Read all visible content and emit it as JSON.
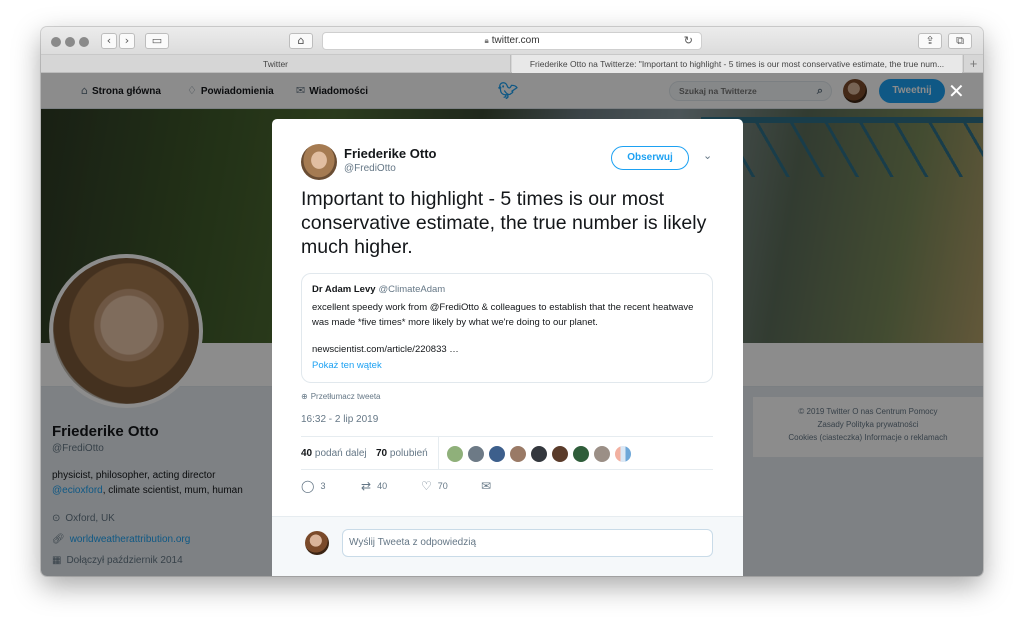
{
  "browser": {
    "url": "twitter.com",
    "tabs": [
      {
        "label": "Twitter"
      },
      {
        "label": "Friederike Otto na Twitterze: \"Important to highlight - 5 times is our most conservative estimate, the true num..."
      }
    ],
    "new_tab_label": "+"
  },
  "navbar": {
    "home": "Strona główna",
    "notifications": "Powiadomienia",
    "messages": "Wiadomości",
    "search_placeholder": "Szukaj na Twitterze",
    "tweet_button": "Tweetnij"
  },
  "profile": {
    "name": "Friederike Otto",
    "handle": "@FrediOtto",
    "bio_part1": "physicist, philosopher, acting director",
    "bio_link": "@ecioxford",
    "bio_part2": ", climate scientist, mum, human",
    "location": "Oxford, UK",
    "website": "worldweatherattribution.org",
    "joined": "Dołączył październik 2014"
  },
  "footer": {
    "line1": "© 2019 Twitter   O nas   Centrum Pomocy",
    "line2": "Zasady   Polityka prywatności",
    "line3": "Cookies (ciasteczka)   Informacje o reklamach"
  },
  "tweet": {
    "author_name": "Friederike Otto",
    "author_handle": "@FrediOtto",
    "follow_label": "Obserwuj",
    "text": "Important to highlight - 5 times is our most conservative estimate, the true number is likely much higher.",
    "quote": {
      "name": "Dr Adam Levy",
      "handle": "@ClimateAdam",
      "body": "excellent speedy work from @FrediOtto & colleagues to establish that the recent heatwave was made *five times* more likely by what we're doing to our planet.",
      "link": "newscientist.com/article/220833 …",
      "show_thread": "Pokaż ten wątek"
    },
    "translate_label": "Przetłumacz tweeta",
    "timestamp": "16:32 - 2 lip 2019",
    "retweets_count": "40",
    "retweets_label": "podań dalej",
    "likes_count": "70",
    "likes_label": "polubień",
    "actions": {
      "reply_count": "3",
      "retweet_count": "40",
      "like_count": "70"
    },
    "reply_placeholder": "Wyślij Tweeta z odpowiedzią"
  },
  "colors": {
    "accent": "#1da1f2",
    "text": "#14171a",
    "muted": "#657786"
  }
}
